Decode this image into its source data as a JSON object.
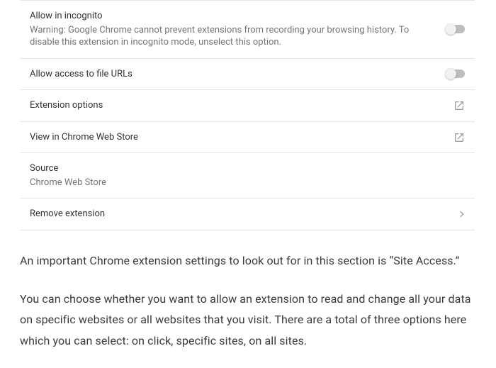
{
  "settings": {
    "incognito": {
      "title": "Allow in incognito",
      "warning": "Warning: Google Chrome cannot prevent extensions from recording your browsing history. To disable this extension in incognito mode, unselect this option."
    },
    "file_urls": {
      "title": "Allow access to file URLs"
    },
    "extension_options": {
      "title": "Extension options"
    },
    "web_store": {
      "title": "View in Chrome Web Store"
    },
    "source": {
      "title": "Source",
      "value": "Chrome Web Store"
    },
    "remove": {
      "title": "Remove extension"
    }
  },
  "article": {
    "p1": "An important Chrome extension settings to look out for in this section is “Site Access.”",
    "p2": "You can choose whether you want to allow an extension to read and change all your data on specific websites or all websites that you visit. There are a total of three options here which you can select: on click, specific sites, on all sites."
  }
}
